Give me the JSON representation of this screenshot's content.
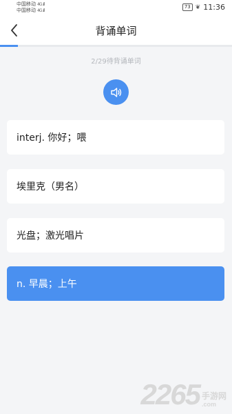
{
  "status_bar": {
    "carrier_1": "中国移动",
    "carrier_2": "中国移动",
    "signal_1": "4G .ıll",
    "signal_2": "4G .ıll",
    "battery": "73",
    "time": "11:36"
  },
  "header": {
    "title": "背诵单词"
  },
  "progress": {
    "current": 2,
    "total": 29,
    "fraction": 0.069,
    "label": "2/29待背诵单词"
  },
  "options": [
    {
      "text": "interj. 你好；喂",
      "selected": false
    },
    {
      "text": "埃里克（男名）",
      "selected": false
    },
    {
      "text": "光盘；激光唱片",
      "selected": false
    },
    {
      "text": "n. 早晨；上午",
      "selected": true
    }
  ],
  "watermark": {
    "number": "2265",
    "cn": "手游网",
    "url": ".com"
  },
  "colors": {
    "accent": "#4a90f0",
    "background": "#f4f5f7"
  },
  "icons": {
    "back": "chevron-left-icon",
    "speaker": "speaker-icon"
  }
}
